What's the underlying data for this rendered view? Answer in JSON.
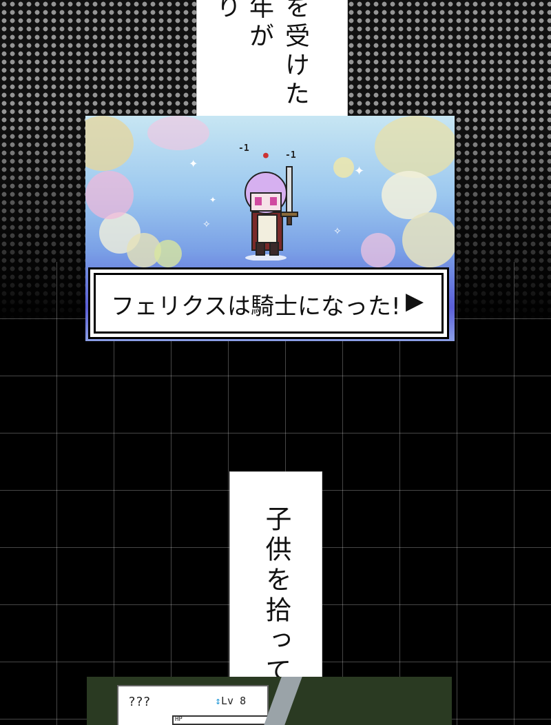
{
  "caption_top": {
    "col1": "を受けた",
    "col2": "年が",
    "col3": "り"
  },
  "caption_mid": {
    "col1": "子供を拾って"
  },
  "game_panel": {
    "dialog_text": "フェリクスは騎士になった!",
    "continue_glyph": "▶",
    "damage_left": "-1",
    "damage_right": "-1"
  },
  "status": {
    "name": "???",
    "level_arrow": "↕",
    "level": "Lv 8",
    "hp_label": "HP"
  }
}
